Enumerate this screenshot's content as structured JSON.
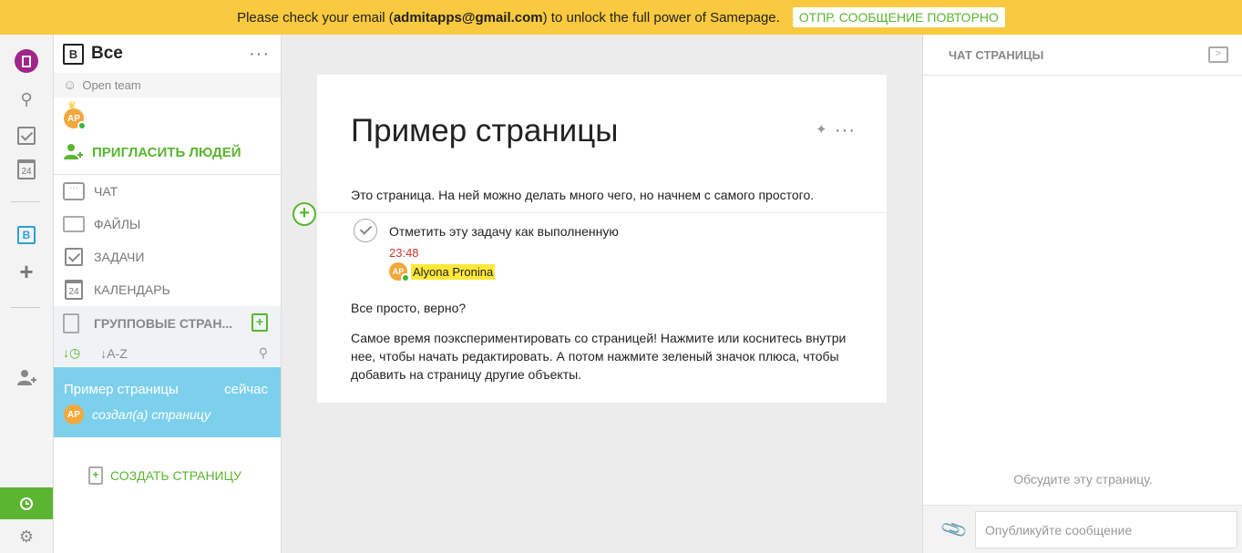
{
  "banner": {
    "text_before": "Please check your email (",
    "email": "admitapps@gmail.com",
    "text_after": ") to unlock the full power of Samepage.",
    "resend_label": "ОТПР. СООБЩЕНИЕ ПОВТОРНО",
    "color": "#f9c93f"
  },
  "rail": {
    "calendar_day": "24",
    "team_badge": "B",
    "icons": [
      "samepage-logo-icon",
      "search-icon",
      "tasks-icon",
      "calendar-icon",
      "team-b-icon",
      "add-icon",
      "add-user-icon",
      "history-icon",
      "settings-icon"
    ]
  },
  "sidebar": {
    "badge": "B",
    "title": "Все",
    "team_label": "Open team",
    "owner_avatar": "AP",
    "invite_label": "ПРИГЛАСИТЬ ЛЮДЕЙ",
    "nav": [
      {
        "label": "ЧАТ"
      },
      {
        "label": "ФАЙЛЫ"
      },
      {
        "label": "ЗАДАЧИ"
      },
      {
        "label": "КАЛЕНДАРЬ"
      }
    ],
    "calendar_day": "24",
    "group_pages_label": "ГРУППОВЫЕ СТРАН...",
    "sort_az": "A-Z",
    "page_item": {
      "title": "Пример страницы",
      "time": "сейчас",
      "avatar": "AP",
      "desc": "создал(а) страницу"
    },
    "create_page_label": "СОЗДАТЬ СТРАНИЦУ"
  },
  "main": {
    "page_title": "Пример страницы",
    "intro": "Это страница. На ней можно делать много чего, но начнем с самого простого.",
    "task": {
      "text": "Отметить эту задачу как выполненную",
      "time": "23:48",
      "avatar": "AP",
      "assignee": "Alyona Pronina"
    },
    "p2": "Все просто, верно?",
    "p3": "Самое время поэкспериментировать со страницей! Нажмите или коснитесь внутри нее, чтобы начать редактировать. А потом нажмите зеленый значок плюса, чтобы добавить на страницу другие объекты."
  },
  "chat": {
    "title": "ЧАТ СТРАНИЦЫ",
    "empty_text": "Обсудите эту страницу.",
    "input_placeholder": "Опубликуйте сообщение"
  },
  "colors": {
    "accent": "#5bb531",
    "selected_item": "#7dd0ec",
    "logo": "#a0268c",
    "time_red": "#d0322d"
  }
}
